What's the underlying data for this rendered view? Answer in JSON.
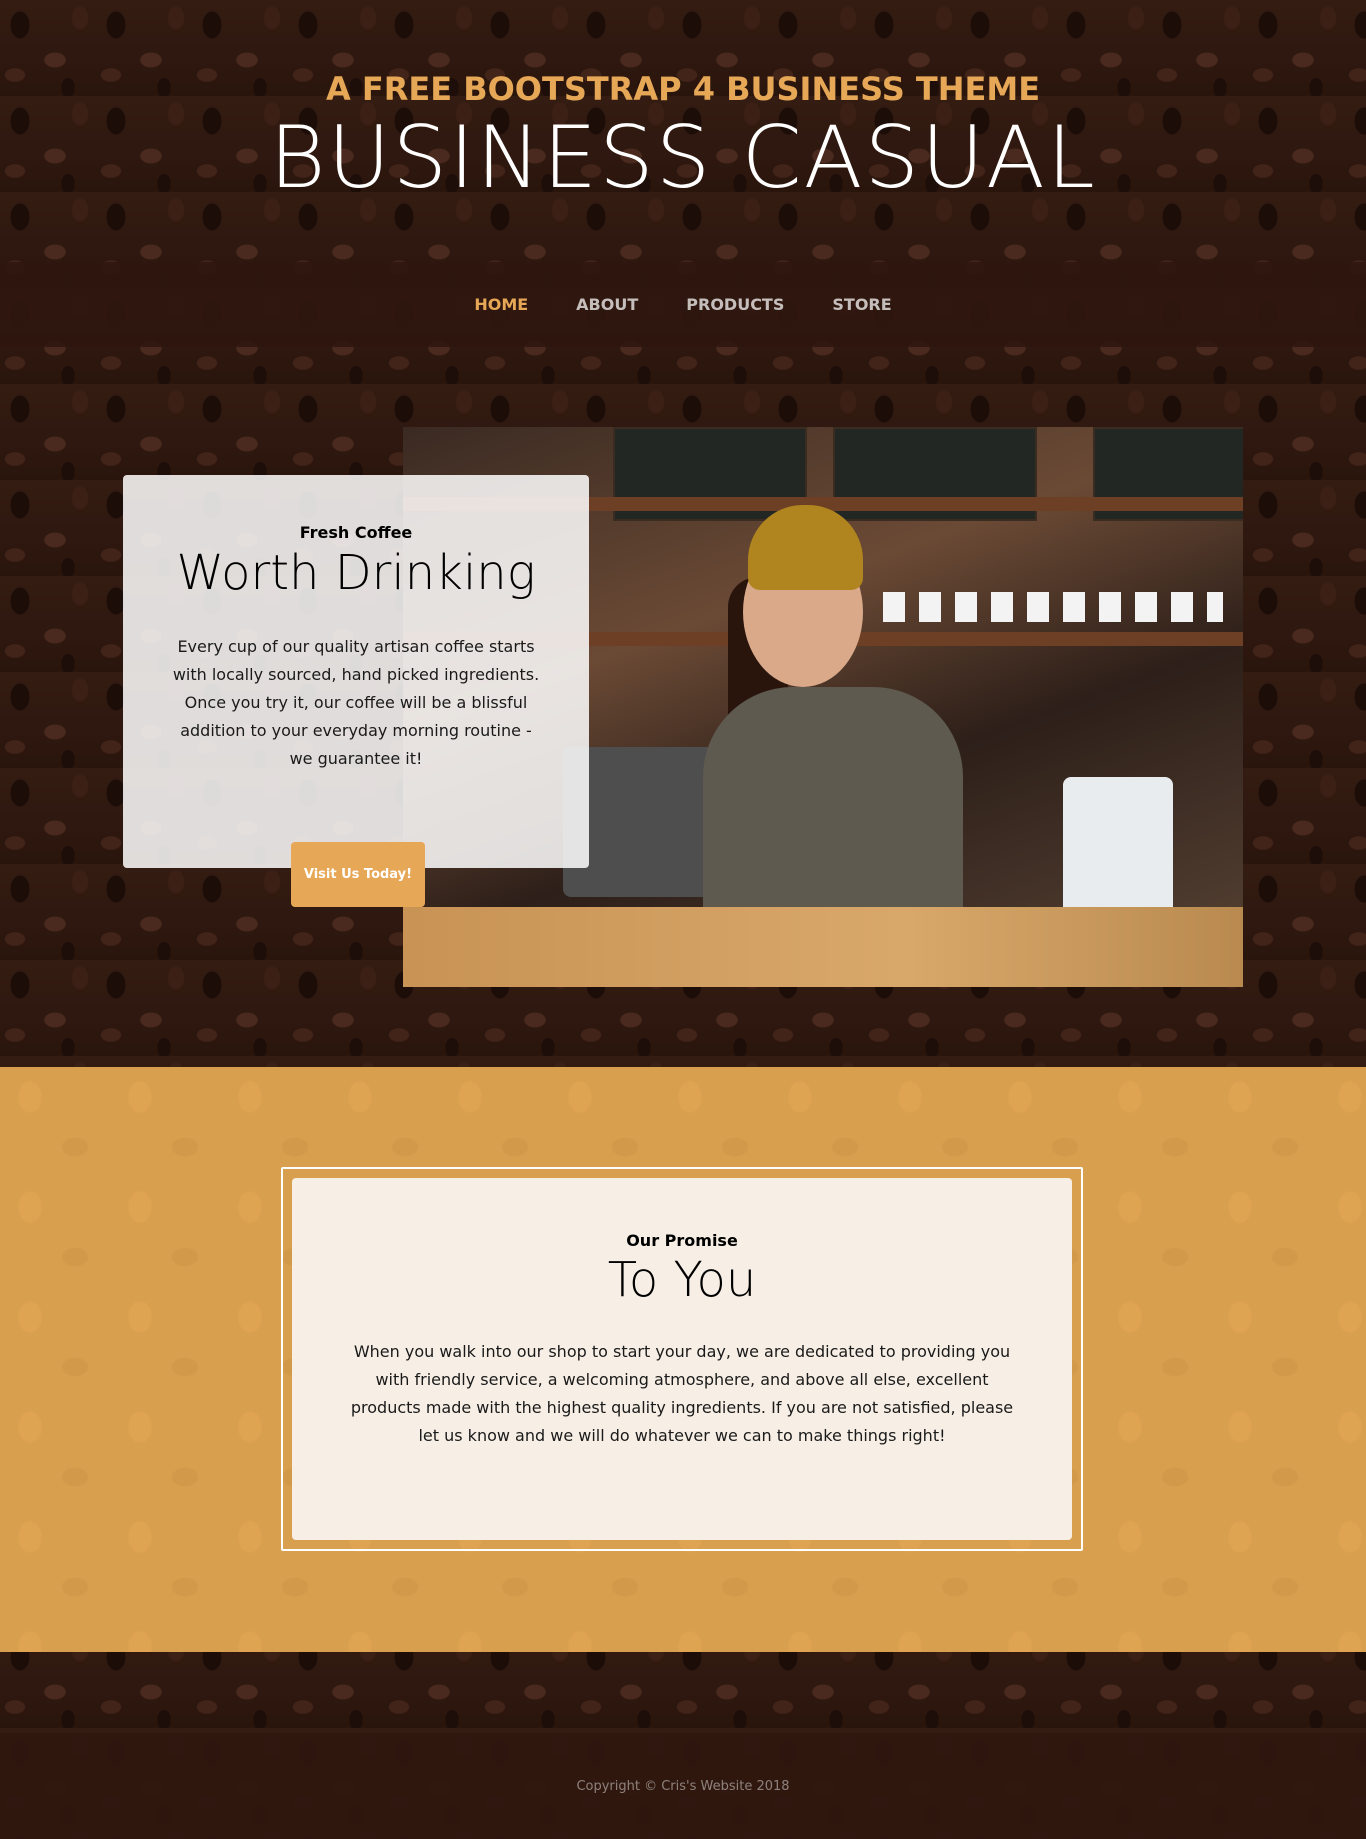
{
  "header": {
    "tagline": "A FREE BOOTSTRAP 4 BUSINESS THEME",
    "brand": "BUSINESS CASUAL"
  },
  "nav": {
    "items": [
      {
        "label": "HOME",
        "active": true
      },
      {
        "label": "ABOUT",
        "active": false
      },
      {
        "label": "PRODUCTS",
        "active": false
      },
      {
        "label": "STORE",
        "active": false
      }
    ]
  },
  "intro": {
    "kicker": "Fresh Coffee",
    "title": "Worth Drinking",
    "text": "Every cup of our quality artisan coffee starts with locally sourced, hand picked ingredients. Once you try it, our coffee will be a blissful addition to your everyday morning routine - we guarantee it!",
    "button_label": "Visit Us Today!"
  },
  "promise": {
    "kicker": "Our Promise",
    "title": "To You",
    "text": "When you walk into our shop to start your day, we are dedicated to providing you with friendly service, a welcoming atmosphere, and above all else, excellent products made with the highest quality ingredients. If you are not satisfied, please let us know and we will do whatever we can to make things right!"
  },
  "footer": {
    "copyright": "Copyright © Cris's Website 2018"
  },
  "colors": {
    "accent": "#e6a756",
    "dark_brown": "#2f170f",
    "promise_bg": "#d89f4e",
    "card_bg": "#f7efe5"
  }
}
